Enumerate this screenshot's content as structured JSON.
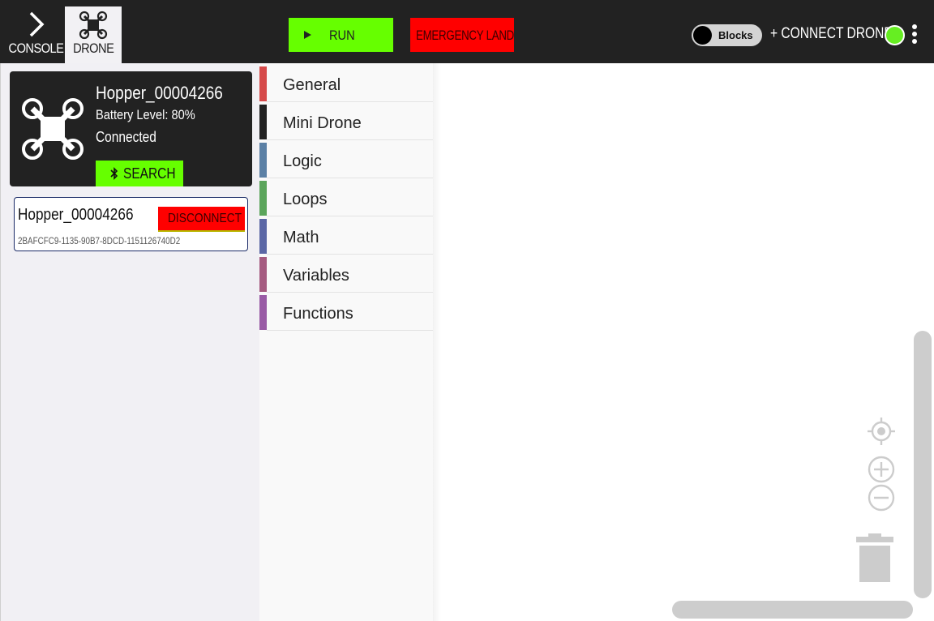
{
  "header": {
    "tabs": [
      {
        "label": "CONSOLE",
        "icon": "chevron-right-icon"
      },
      {
        "label": "DRONE",
        "icon": "drone-icon"
      }
    ],
    "run_label": "RUN",
    "emergency_label": "EMERGENCY LAND",
    "blocks_toggle_label": "Blocks",
    "connect_label": "+ CONNECT DRONE",
    "connection_status_color": "#66ee22"
  },
  "drone_panel": {
    "card": {
      "name": "Hopper_00004266",
      "battery": "Battery Level: 80%",
      "status": "Connected",
      "search_label": "SEARCH"
    },
    "devices": [
      {
        "name": "Hopper_00004266",
        "uuid": "2BAFCFC9-1135-90B7-8DCD-1151126740D2",
        "action_label": "DISCONNECT"
      }
    ]
  },
  "toolbox": {
    "categories": [
      {
        "label": "General",
        "color": "#d64a4a"
      },
      {
        "label": "Mini Drone",
        "color": "#222222"
      },
      {
        "label": "Logic",
        "color": "#5b80a5"
      },
      {
        "label": "Loops",
        "color": "#5ba55b"
      },
      {
        "label": "Math",
        "color": "#5b67a5"
      },
      {
        "label": "Variables",
        "color": "#a55b80"
      },
      {
        "label": "Functions",
        "color": "#995ba5"
      }
    ]
  },
  "workspace": {
    "controls": [
      "target-icon",
      "zoom-in-icon",
      "zoom-out-icon",
      "trash-icon"
    ]
  },
  "colors": {
    "accent_green": "#66ff00",
    "danger_red": "#ff0000",
    "topbar": "#222222"
  }
}
